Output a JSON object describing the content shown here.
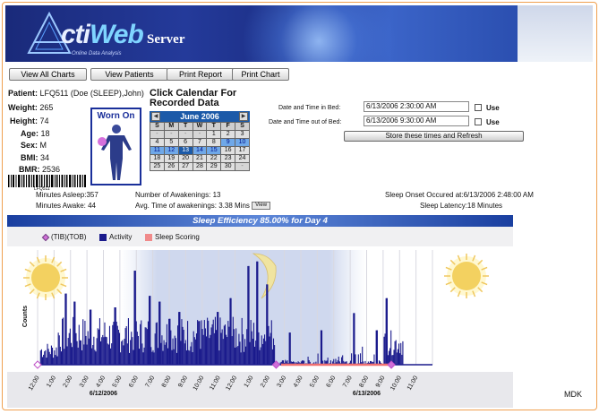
{
  "app": {
    "brand_prefix": "cti",
    "brand_web": "Web",
    "brand_server": "Server",
    "tagline": "Online Data Analysis"
  },
  "toolbar": {
    "view_all_charts": "View All Charts",
    "view_patients": "View Patients",
    "print_report": "Print Report",
    "print_chart": "Print Chart"
  },
  "patient": {
    "patient_label": "Patient:",
    "patient_value": "LFQ511 (Doe (SLEEP),John)",
    "weight_label": "Weight:",
    "weight_value": "265",
    "height_label": "Height:",
    "height_value": "74",
    "age_label": "Age:",
    "age_value": "18",
    "sex_label": "Sex:",
    "sex_value": "M",
    "bmi_label": "BMI:",
    "bmi_value": "34",
    "bmr_label": "BMR:",
    "bmr_value": "2536",
    "barcode_text": "LFQ511"
  },
  "worn_on": {
    "title": "Worn On"
  },
  "calendar": {
    "heading": "Click Calendar For Recorded Data",
    "month": "June 2006",
    "prev": "◀",
    "next": "▶",
    "weekdays": [
      "S",
      "M",
      "T",
      "W",
      "T",
      "F",
      "S"
    ],
    "weeks": [
      [
        "-",
        "-",
        "-",
        "-",
        "1",
        "2",
        "3"
      ],
      [
        "4",
        "5",
        "6",
        "7",
        "8",
        "9",
        "10"
      ],
      [
        "11",
        "12",
        "13",
        "14",
        "15",
        "16",
        "17"
      ],
      [
        "18",
        "19",
        "20",
        "21",
        "22",
        "23",
        "24"
      ],
      [
        "25",
        "26",
        "27",
        "28",
        "29",
        "30",
        "-"
      ]
    ],
    "recorded_days": [
      "9",
      "10",
      "11",
      "12",
      "13",
      "14",
      "15"
    ],
    "selected_day": "13"
  },
  "times": {
    "in_bed_label": "Date and Time in Bed:",
    "in_bed_value": "6/13/2006 2:30:00 AM",
    "out_bed_label": "Date and Time out of Bed:",
    "out_bed_value": "6/13/2006 9:30:00 AM",
    "use_label": "Use",
    "store_button": "Store these times and Refresh"
  },
  "stats": {
    "minutes_asleep": "Minutes Asleep:357",
    "minutes_awake": "Minutes Awake: 44",
    "awakenings": "Number of Awakenings: 13",
    "avg_awakenings": "Avg. Time of awakenings: 3.38 Mins",
    "view_button": "View",
    "sleep_onset": "Sleep Onset Occured at:6/13/2006 2:48:00 AM",
    "sleep_latency": "Sleep Latency:18 Minutes"
  },
  "chart_title": "Sleep Efficiency 85.00% for Day 4",
  "legend": {
    "tib_tob": "(TIB)(TOB)",
    "activity": "Activity",
    "sleep_scoring": "Sleep Scoring"
  },
  "colors": {
    "activity": "#1a1a8c",
    "sleep_scoring": "#f08a8a",
    "marker": "#d070d8",
    "title_bar": "#1a3fa0"
  },
  "chart_data": {
    "type": "bar",
    "ylabel": "Counts",
    "xlabel": "",
    "x_ticks": [
      "12:00",
      "1:00",
      "2:00",
      "3:00",
      "4:00",
      "5:00",
      "6:00",
      "7:00",
      "8:00",
      "9:00",
      "10:00",
      "11:00",
      "12:00",
      "1:00",
      "2:00",
      "3:00",
      "4:00",
      "5:00",
      "6:00",
      "7:00",
      "8:00",
      "9:00",
      "10:00",
      "11:00"
    ],
    "date_labels": [
      {
        "label": "6/12/2006",
        "hour": 4
      },
      {
        "label": "6/13/2006",
        "hour": 20
      }
    ],
    "x_range_hours": [
      0,
      24
    ],
    "tib_marker_hours": [
      0,
      14.5,
      21.5
    ],
    "sleep_scoring_span_hours": [
      14.8,
      21.5
    ],
    "night_shade_hours": [
      5,
      20
    ],
    "grid": true,
    "activity_peaks": [
      {
        "hour": 1.7,
        "value": 0.62
      },
      {
        "hour": 2.2,
        "value": 0.55
      },
      {
        "hour": 3.2,
        "value": 0.48
      },
      {
        "hour": 4.7,
        "value": 0.5
      },
      {
        "hour": 5.9,
        "value": 0.82
      },
      {
        "hour": 6.8,
        "value": 0.6
      },
      {
        "hour": 7.4,
        "value": 0.55
      },
      {
        "hour": 8.0,
        "value": 0.4
      },
      {
        "hour": 8.6,
        "value": 0.46
      },
      {
        "hour": 9.8,
        "value": 0.38
      },
      {
        "hour": 10.9,
        "value": 0.46
      },
      {
        "hour": 11.7,
        "value": 0.58
      },
      {
        "hour": 12.8,
        "value": 0.86
      },
      {
        "hour": 13.3,
        "value": 0.9
      },
      {
        "hour": 13.9,
        "value": 0.7
      },
      {
        "hour": 15.3,
        "value": 0.28
      },
      {
        "hour": 17.2,
        "value": 0.3
      },
      {
        "hour": 19.2,
        "value": 0.45
      },
      {
        "hour": 20.6,
        "value": 0.3
      },
      {
        "hour": 21.2,
        "value": 0.58
      }
    ]
  }
}
